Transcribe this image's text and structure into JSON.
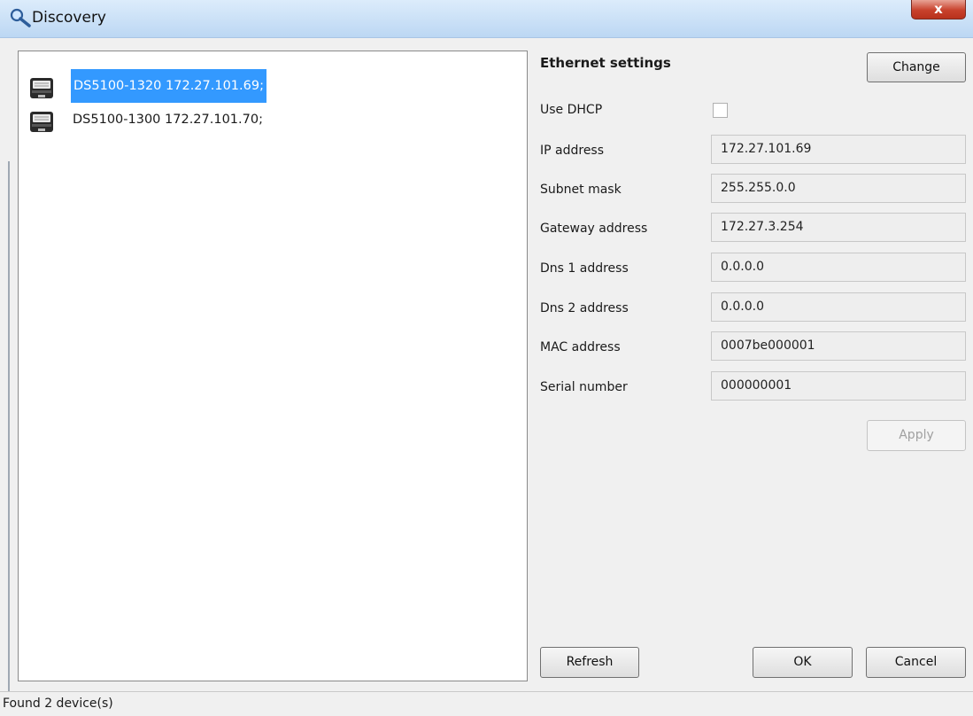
{
  "window": {
    "title": "Discovery",
    "close_symbol": "x"
  },
  "device_list": {
    "items": [
      {
        "label": "DS5100-1320 172.27.101.69;",
        "selected": true,
        "icon": "printer-icon"
      },
      {
        "label": "DS5100-1300 172.27.101.70;",
        "selected": false,
        "icon": "printer-icon"
      }
    ]
  },
  "ethernet": {
    "title": "Ethernet settings",
    "change_label": "Change",
    "use_dhcp_label": "Use DHCP",
    "use_dhcp_checked": false,
    "fields": [
      {
        "label": "IP address",
        "value": "172.27.101.69"
      },
      {
        "label": "Subnet mask",
        "value": "255.255.0.0"
      },
      {
        "label": "Gateway address",
        "value": "172.27.3.254"
      },
      {
        "label": "Dns 1 address",
        "value": "0.0.0.0"
      },
      {
        "label": "Dns 2 address",
        "value": "0.0.0.0"
      },
      {
        "label": "MAC address",
        "value": "0007be000001"
      },
      {
        "label": "Serial number",
        "value": "000000001"
      }
    ],
    "apply_label": "Apply"
  },
  "buttons": {
    "refresh": "Refresh",
    "ok": "OK",
    "cancel": "Cancel"
  },
  "status": {
    "text": "Found 2 device(s)"
  },
  "colors": {
    "selection": "#3399ff",
    "title_bar": "#c9def5",
    "close_button": "#c8412c"
  }
}
